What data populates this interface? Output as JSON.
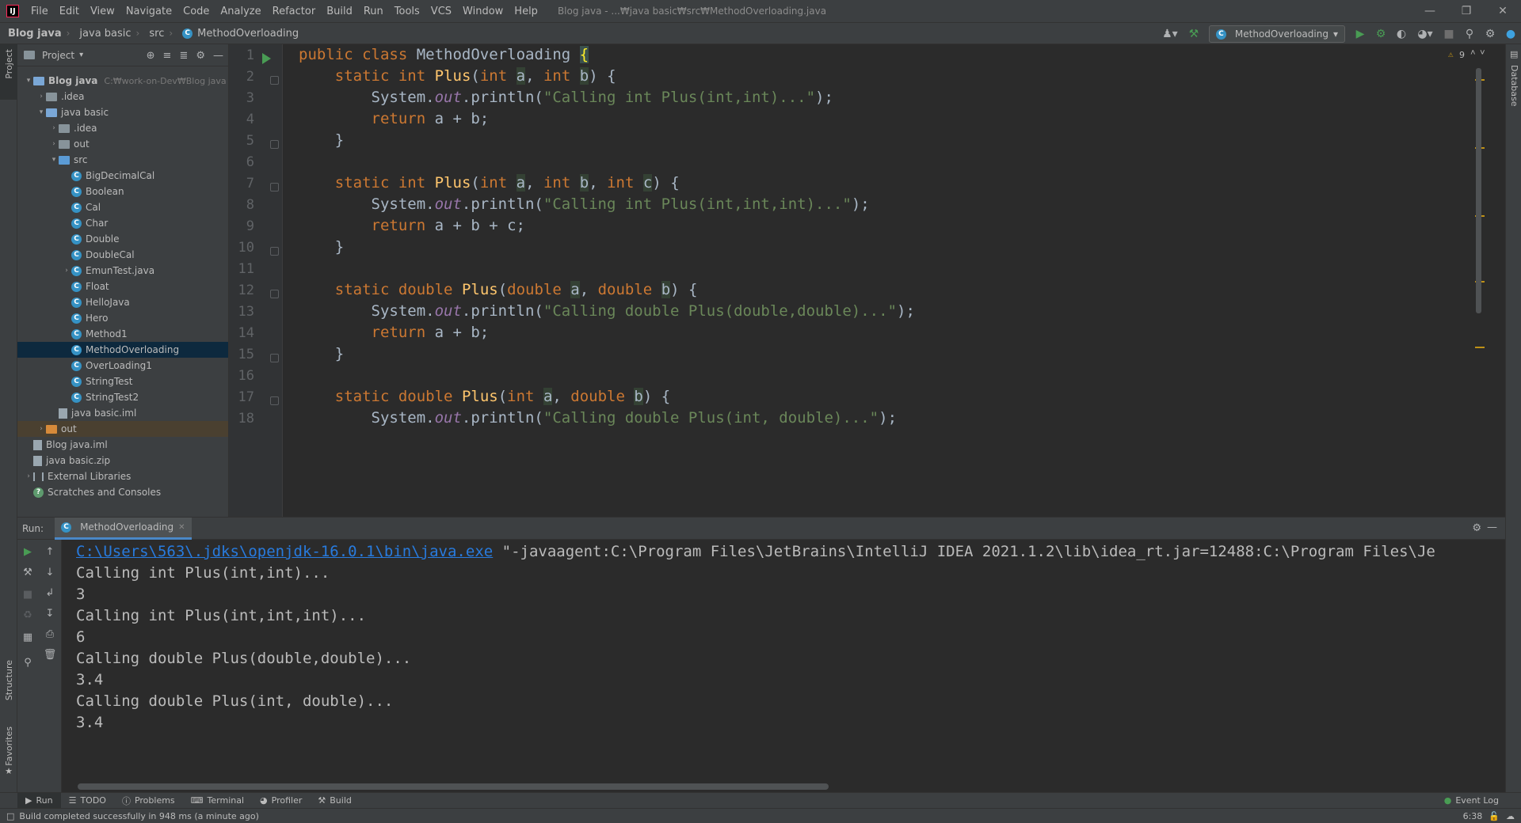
{
  "app": {
    "logo": "IJ"
  },
  "menu": [
    "File",
    "Edit",
    "View",
    "Navigate",
    "Code",
    "Analyze",
    "Refactor",
    "Build",
    "Run",
    "Tools",
    "VCS",
    "Window",
    "Help"
  ],
  "window_title": "Blog java - ...₩java basic₩src₩MethodOverloading.java",
  "breadcrumb": [
    "Blog java",
    "java basic",
    "src",
    "MethodOverloading"
  ],
  "toolbar": {
    "run_config": "MethodOverloading"
  },
  "left_strip": {
    "project": "Project",
    "structure": "Structure",
    "favorites": "Favorites"
  },
  "right_strip": {
    "database": "Database"
  },
  "project_panel": {
    "title": "Project",
    "tree": [
      {
        "label": "Blog java",
        "path": "C:₩work-on-Dev₩Blog java",
        "icon": "folder",
        "arrow": "⌄"
      },
      {
        "label": ".idea",
        "icon": "folder",
        "arrow": "›"
      },
      {
        "label": "java basic",
        "icon": "folder",
        "arrow": "⌄"
      },
      {
        "label": ".idea",
        "icon": "folder",
        "arrow": "›"
      },
      {
        "label": "out",
        "icon": "folder",
        "arrow": "›"
      },
      {
        "label": "src",
        "icon": "folder-src",
        "arrow": "⌄"
      },
      {
        "label": "BigDecimalCal",
        "icon": "class"
      },
      {
        "label": "Boolean",
        "icon": "class"
      },
      {
        "label": "Cal",
        "icon": "class"
      },
      {
        "label": "Char",
        "icon": "class"
      },
      {
        "label": "Double",
        "icon": "class"
      },
      {
        "label": "DoubleCal",
        "icon": "class"
      },
      {
        "label": "EmunTest.java",
        "icon": "class",
        "arrow": "›"
      },
      {
        "label": "Float",
        "icon": "class"
      },
      {
        "label": "HelloJava",
        "icon": "class"
      },
      {
        "label": "Hero",
        "icon": "class"
      },
      {
        "label": "Method1",
        "icon": "class"
      },
      {
        "label": "MethodOverloading",
        "icon": "class"
      },
      {
        "label": "OverLoading1",
        "icon": "class"
      },
      {
        "label": "StringTest",
        "icon": "class"
      },
      {
        "label": "StringTest2",
        "icon": "class"
      },
      {
        "label": "java basic.iml",
        "icon": "file"
      },
      {
        "label": "out",
        "icon": "folder-excluded",
        "arrow": "›"
      },
      {
        "label": "Blog java.iml",
        "icon": "file"
      },
      {
        "label": "java basic.zip",
        "icon": "file"
      },
      {
        "label": "External Libraries",
        "icon": "library",
        "arrow": "›"
      },
      {
        "label": "Scratches and Consoles",
        "icon": "scratch"
      }
    ]
  },
  "editor": {
    "warnings": "9",
    "line_numbers": [
      "1",
      "2",
      "3",
      "4",
      "5",
      "6",
      "7",
      "8",
      "9",
      "10",
      "11",
      "12",
      "13",
      "14",
      "15",
      "16",
      "17",
      "18"
    ],
    "lines": [
      "public class MethodOverloading {",
      "    static int Plus(int a, int b) {",
      "        System.out.println(\"Calling int Plus(int,int)...\");",
      "        return a + b;",
      "    }",
      "",
      "    static int Plus(int a, int b, int c) {",
      "        System.out.println(\"Calling int Plus(int,int,int)...\");",
      "        return a + b + c;",
      "    }",
      "",
      "    static double Plus(double a, double b) {",
      "        System.out.println(\"Calling double Plus(double,double)...\");",
      "        return a + b;",
      "    }",
      "",
      "    static double Plus(int a, double b) {",
      "        System.out.println(\"Calling double Plus(int, double)...\");"
    ]
  },
  "run_panel": {
    "label": "Run:",
    "tab": "MethodOverloading",
    "console_link": "C:\\Users\\563\\.jdks\\openjdk-16.0.1\\bin\\java.exe",
    "console_cmd": " \"-javaagent:C:\\Program Files\\JetBrains\\IntelliJ IDEA 2021.1.2\\lib\\idea_rt.jar=12488:C:\\Program Files\\Je",
    "output": [
      "Calling int Plus(int,int)...",
      "3",
      "Calling int Plus(int,int,int)...",
      "6",
      "Calling double Plus(double,double)...",
      "3.4",
      "Calling double Plus(int, double)...",
      "3.4"
    ]
  },
  "bottom_tabs": [
    "Run",
    "TODO",
    "Problems",
    "Terminal",
    "Profiler",
    "Build"
  ],
  "event_log": "Event Log",
  "status": {
    "message": "Build completed successfully in 948 ms (a minute ago)",
    "position": "6:38"
  }
}
